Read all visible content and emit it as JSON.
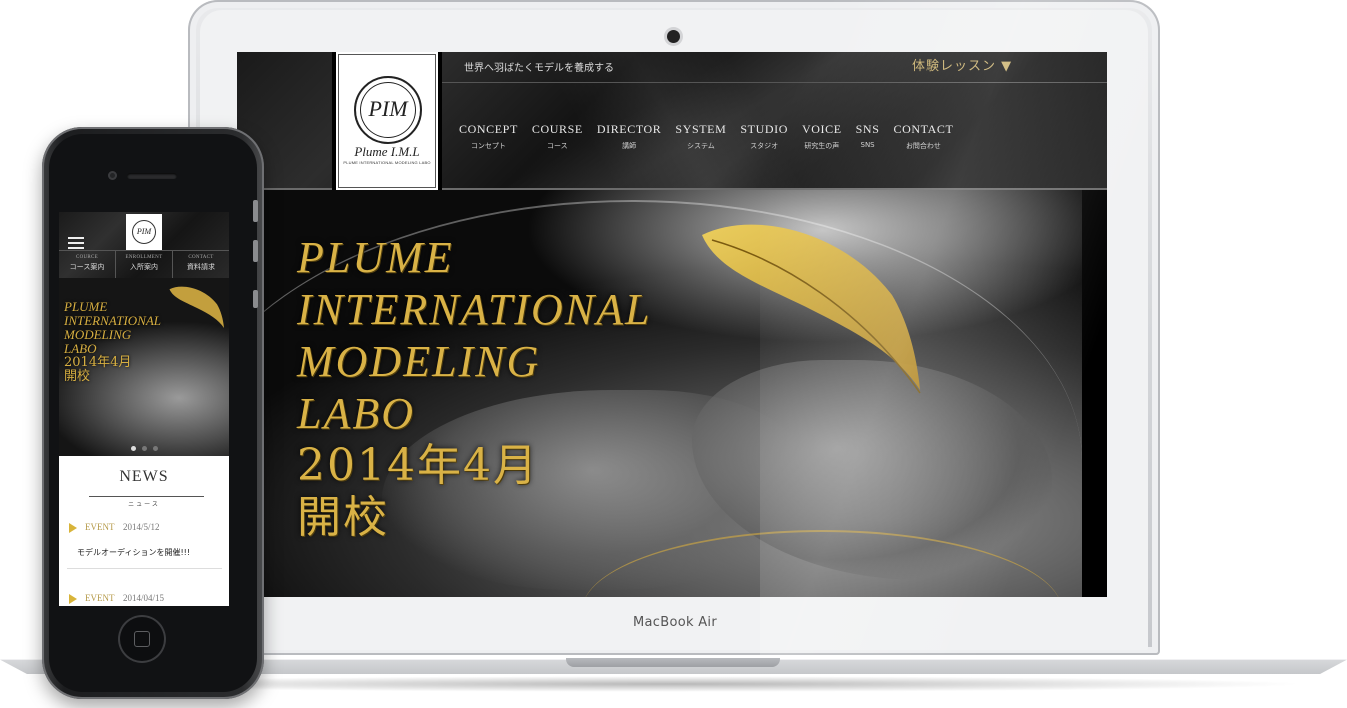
{
  "laptop": {
    "brand_label": "MacBook Air"
  },
  "site": {
    "tagline": "世界へ羽ばたくモデルを養成する",
    "trial_label": "体験レッスン ▼",
    "logo": {
      "monogram": "PIM",
      "wordmark": "Plume I.M.L",
      "subtitle": "PLUME INTERNATIONAL MODELING LABO"
    },
    "nav": [
      {
        "en": "CONCEPT",
        "ja": "コンセプト"
      },
      {
        "en": "COURSE",
        "ja": "コース"
      },
      {
        "en": "DIRECTOR",
        "ja": "講師"
      },
      {
        "en": "SYSTEM",
        "ja": "システム"
      },
      {
        "en": "STUDIO",
        "ja": "スタジオ"
      },
      {
        "en": "VOICE",
        "ja": "研究生の声"
      },
      {
        "en": "SNS",
        "ja": "SNS"
      },
      {
        "en": "CONTACT",
        "ja": "お問合わせ"
      }
    ],
    "hero_lines": [
      "PLUME",
      "INTERNATIONAL",
      "MODELING",
      "LABO",
      "2014年4月",
      "開校"
    ],
    "accent_gold": "#d9b246"
  },
  "mobile": {
    "subnav": [
      {
        "en": "COURCE",
        "ja": "コース案内"
      },
      {
        "en": "ENROLLMENT",
        "ja": "入所案内"
      },
      {
        "en": "CONTACT",
        "ja": "資料請求"
      }
    ],
    "hero_lines": [
      "PLUME",
      "INTERNATIONAL",
      "MODELING",
      "LABO",
      "2014年4月",
      "開校"
    ],
    "news_title": "NEWS",
    "news_subtitle": "ニュース",
    "news": [
      {
        "category": "EVENT",
        "date": "2014/5/12",
        "text": "モデルオーディションを開催!!!"
      },
      {
        "category": "EVENT",
        "date": "2014/04/15",
        "text": ""
      }
    ]
  }
}
